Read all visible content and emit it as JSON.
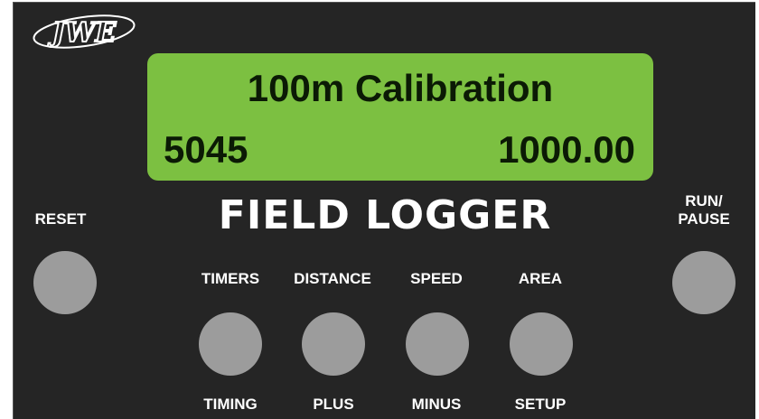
{
  "lcd": {
    "title": "100m Calibration",
    "left_value": "5045",
    "right_value": "1000.00",
    "color": "#7cc041"
  },
  "brand": "FIELD LOGGER",
  "buttons": {
    "reset": {
      "label": "RESET"
    },
    "run_pause": {
      "label": "RUN/\nPAUSE"
    },
    "timers": {
      "top_label": "TIMERS",
      "bottom_label": "TIMING"
    },
    "distance": {
      "top_label": "DISTANCE",
      "bottom_label": "PLUS"
    },
    "speed": {
      "top_label": "SPEED",
      "bottom_label": "MINUS"
    },
    "area": {
      "top_label": "AREA",
      "bottom_label": "SETUP"
    }
  },
  "colors": {
    "panel": "#252525",
    "button": "#9c9c9c",
    "text": "#ffffff"
  }
}
